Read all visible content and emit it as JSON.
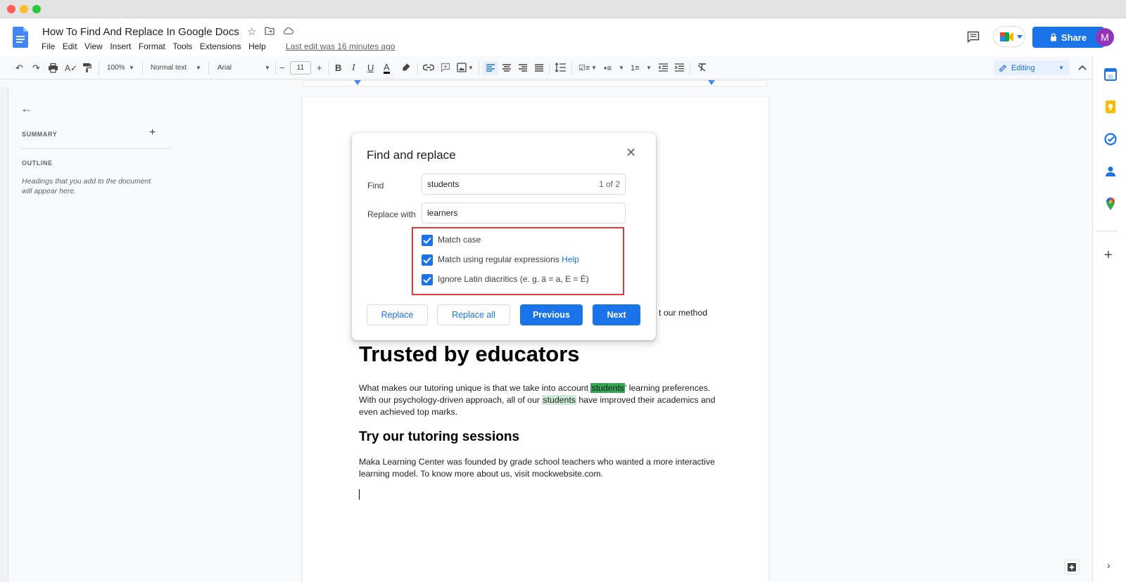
{
  "window": {
    "traffic_lights": [
      "#ff5f57",
      "#febc2e",
      "#28c840"
    ]
  },
  "header": {
    "title": "How To Find And Replace In Google Docs",
    "menu": [
      "File",
      "Edit",
      "View",
      "Insert",
      "Format",
      "Tools",
      "Extensions",
      "Help"
    ],
    "last_edit": "Last edit was 16 minutes ago",
    "share_label": "Share",
    "avatar_initial": "M"
  },
  "toolbar": {
    "zoom": "100%",
    "style": "Normal text",
    "font": "Arial",
    "font_size": "11",
    "mode": "Editing"
  },
  "outline": {
    "summary_label": "SUMMARY",
    "outline_label": "OUTLINE",
    "placeholder": "Headings that you add to the document will appear here."
  },
  "document": {
    "partial_line_end": "t our method",
    "heading1": "Trusted by educators",
    "para1_a": "What makes our tutoring unique is that we take into account ",
    "para1_hl1": "students",
    "para1_b": "' learning preferences.",
    "para1_c": "With our psychology-driven approach, all of our ",
    "para1_hl2": "students",
    "para1_d": " have improved their academics and",
    "para1_e": "even achieved top marks.",
    "heading2": "Try our tutoring sessions",
    "para2_a": "Maka Learning Center was founded by grade school teachers who wanted a more interactive",
    "para2_b": "learning model. To know more about us, visit mockwebsite.com."
  },
  "dialog": {
    "title": "Find and replace",
    "find_label": "Find",
    "find_value": "students",
    "match_count": "1 of 2",
    "replace_label": "Replace with",
    "replace_value": "learners",
    "options": {
      "match_case": "Match case",
      "regex": "Match using regular expressions",
      "regex_help": "Help",
      "diacritics": "Ignore Latin diacritics (e. g. ä = a, E = É)"
    },
    "buttons": {
      "replace": "Replace",
      "replace_all": "Replace all",
      "previous": "Previous",
      "next": "Next"
    }
  },
  "colors": {
    "accent": "#1a73e8",
    "highlight_current": "#34a853",
    "highlight_other": "#ceead6",
    "annotation": "#e53935"
  }
}
